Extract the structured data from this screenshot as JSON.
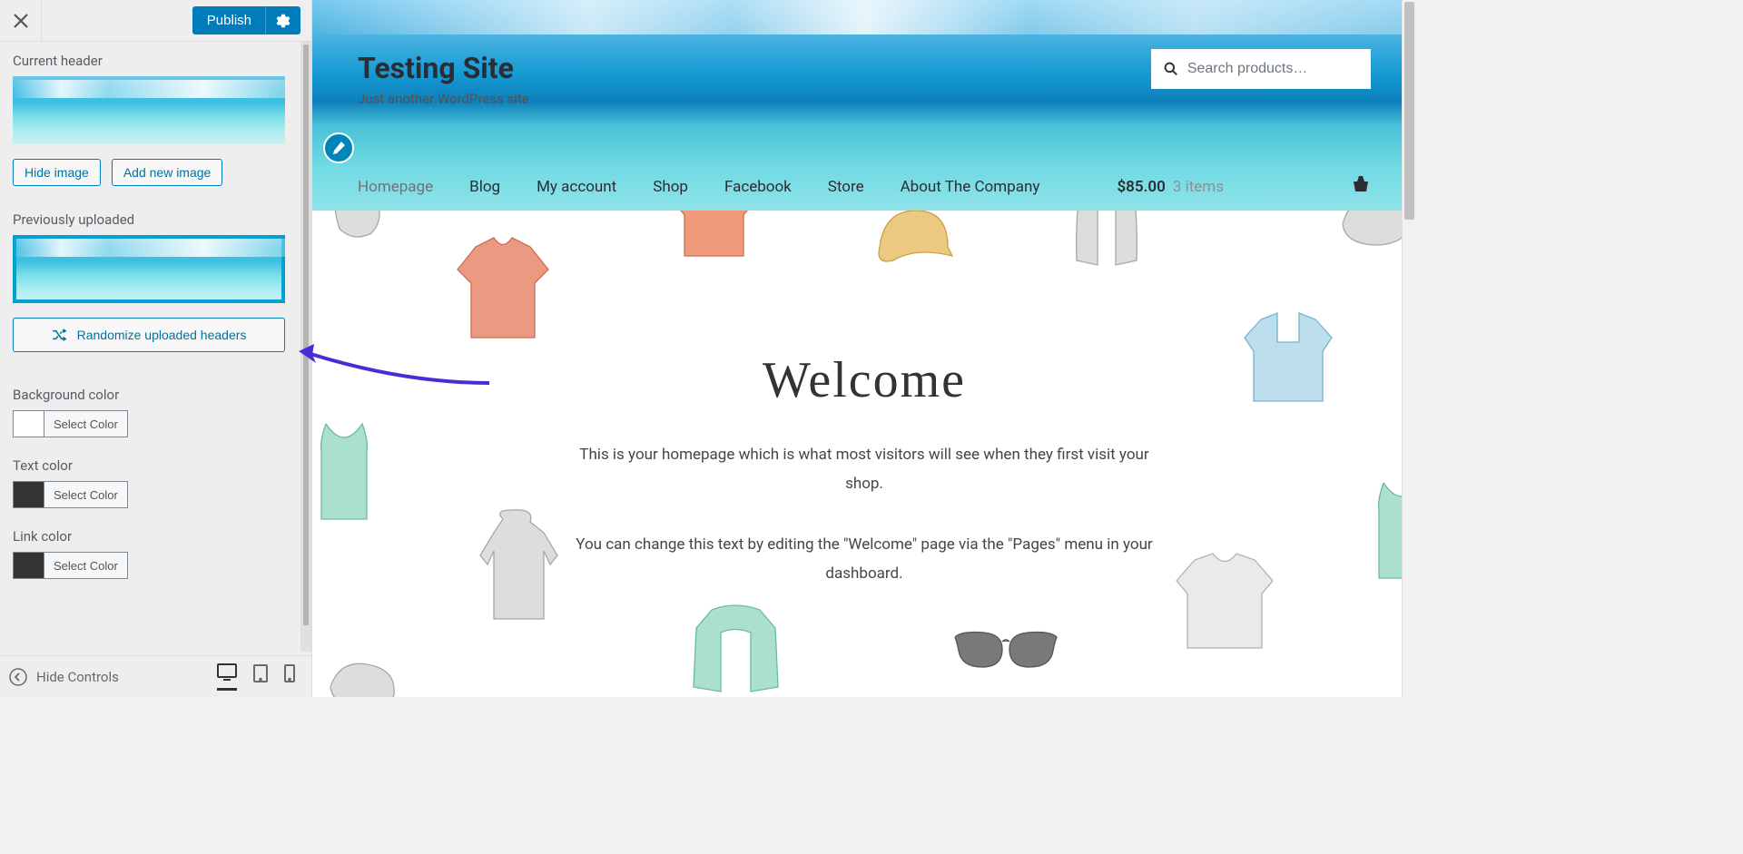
{
  "header": {
    "publish_label": "Publish"
  },
  "sidebar": {
    "current_header_label": "Current header",
    "hide_image_label": "Hide image",
    "add_new_label": "Add new image",
    "previously_uploaded_label": "Previously uploaded",
    "randomize_label": "Randomize uploaded headers",
    "background_color_label": "Background color",
    "text_color_label": "Text color",
    "link_color_label": "Link color",
    "select_color_label": "Select Color",
    "hide_controls_label": "Hide Controls"
  },
  "preview": {
    "site_title": "Testing Site",
    "tagline": "Just another WordPress site",
    "search_placeholder": "Search products…",
    "nav": {
      "homepage": "Homepage",
      "blog": "Blog",
      "my_account": "My account",
      "shop": "Shop",
      "facebook": "Facebook",
      "store": "Store",
      "about": "About The Company"
    },
    "cart": {
      "amount": "$85.00",
      "items": "3 items"
    },
    "content": {
      "title": "Welcome",
      "p1": "This is your homepage which is what most visitors will see when they first visit your shop.",
      "p2": "You can change this text by editing the \"Welcome\" page via the \"Pages\" menu in your dashboard."
    }
  }
}
